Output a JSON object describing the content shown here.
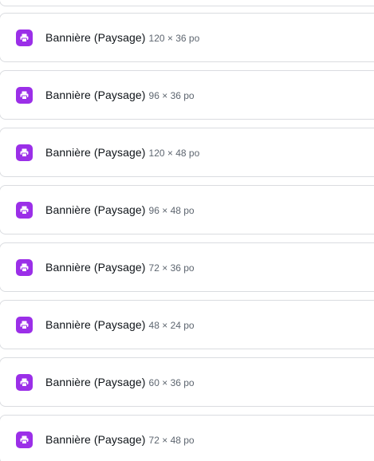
{
  "items": [
    {
      "name": "Bannière (Paysage)",
      "dims": "120 × 36 po"
    },
    {
      "name": "Bannière (Paysage)",
      "dims": "96 × 36 po"
    },
    {
      "name": "Bannière (Paysage)",
      "dims": "120 × 48 po"
    },
    {
      "name": "Bannière (Paysage)",
      "dims": "96 × 48 po"
    },
    {
      "name": "Bannière (Paysage)",
      "dims": "72 × 36 po"
    },
    {
      "name": "Bannière (Paysage)",
      "dims": "48 × 24 po"
    },
    {
      "name": "Bannière (Paysage)",
      "dims": "60 × 36 po"
    },
    {
      "name": "Bannière (Paysage)",
      "dims": "72 × 48 po"
    }
  ],
  "colors": {
    "icon_bg": "#9b2fe8",
    "border": "#dadce0",
    "text": "#0e1318",
    "muted": "#5e6670"
  },
  "icon": "print-icon"
}
